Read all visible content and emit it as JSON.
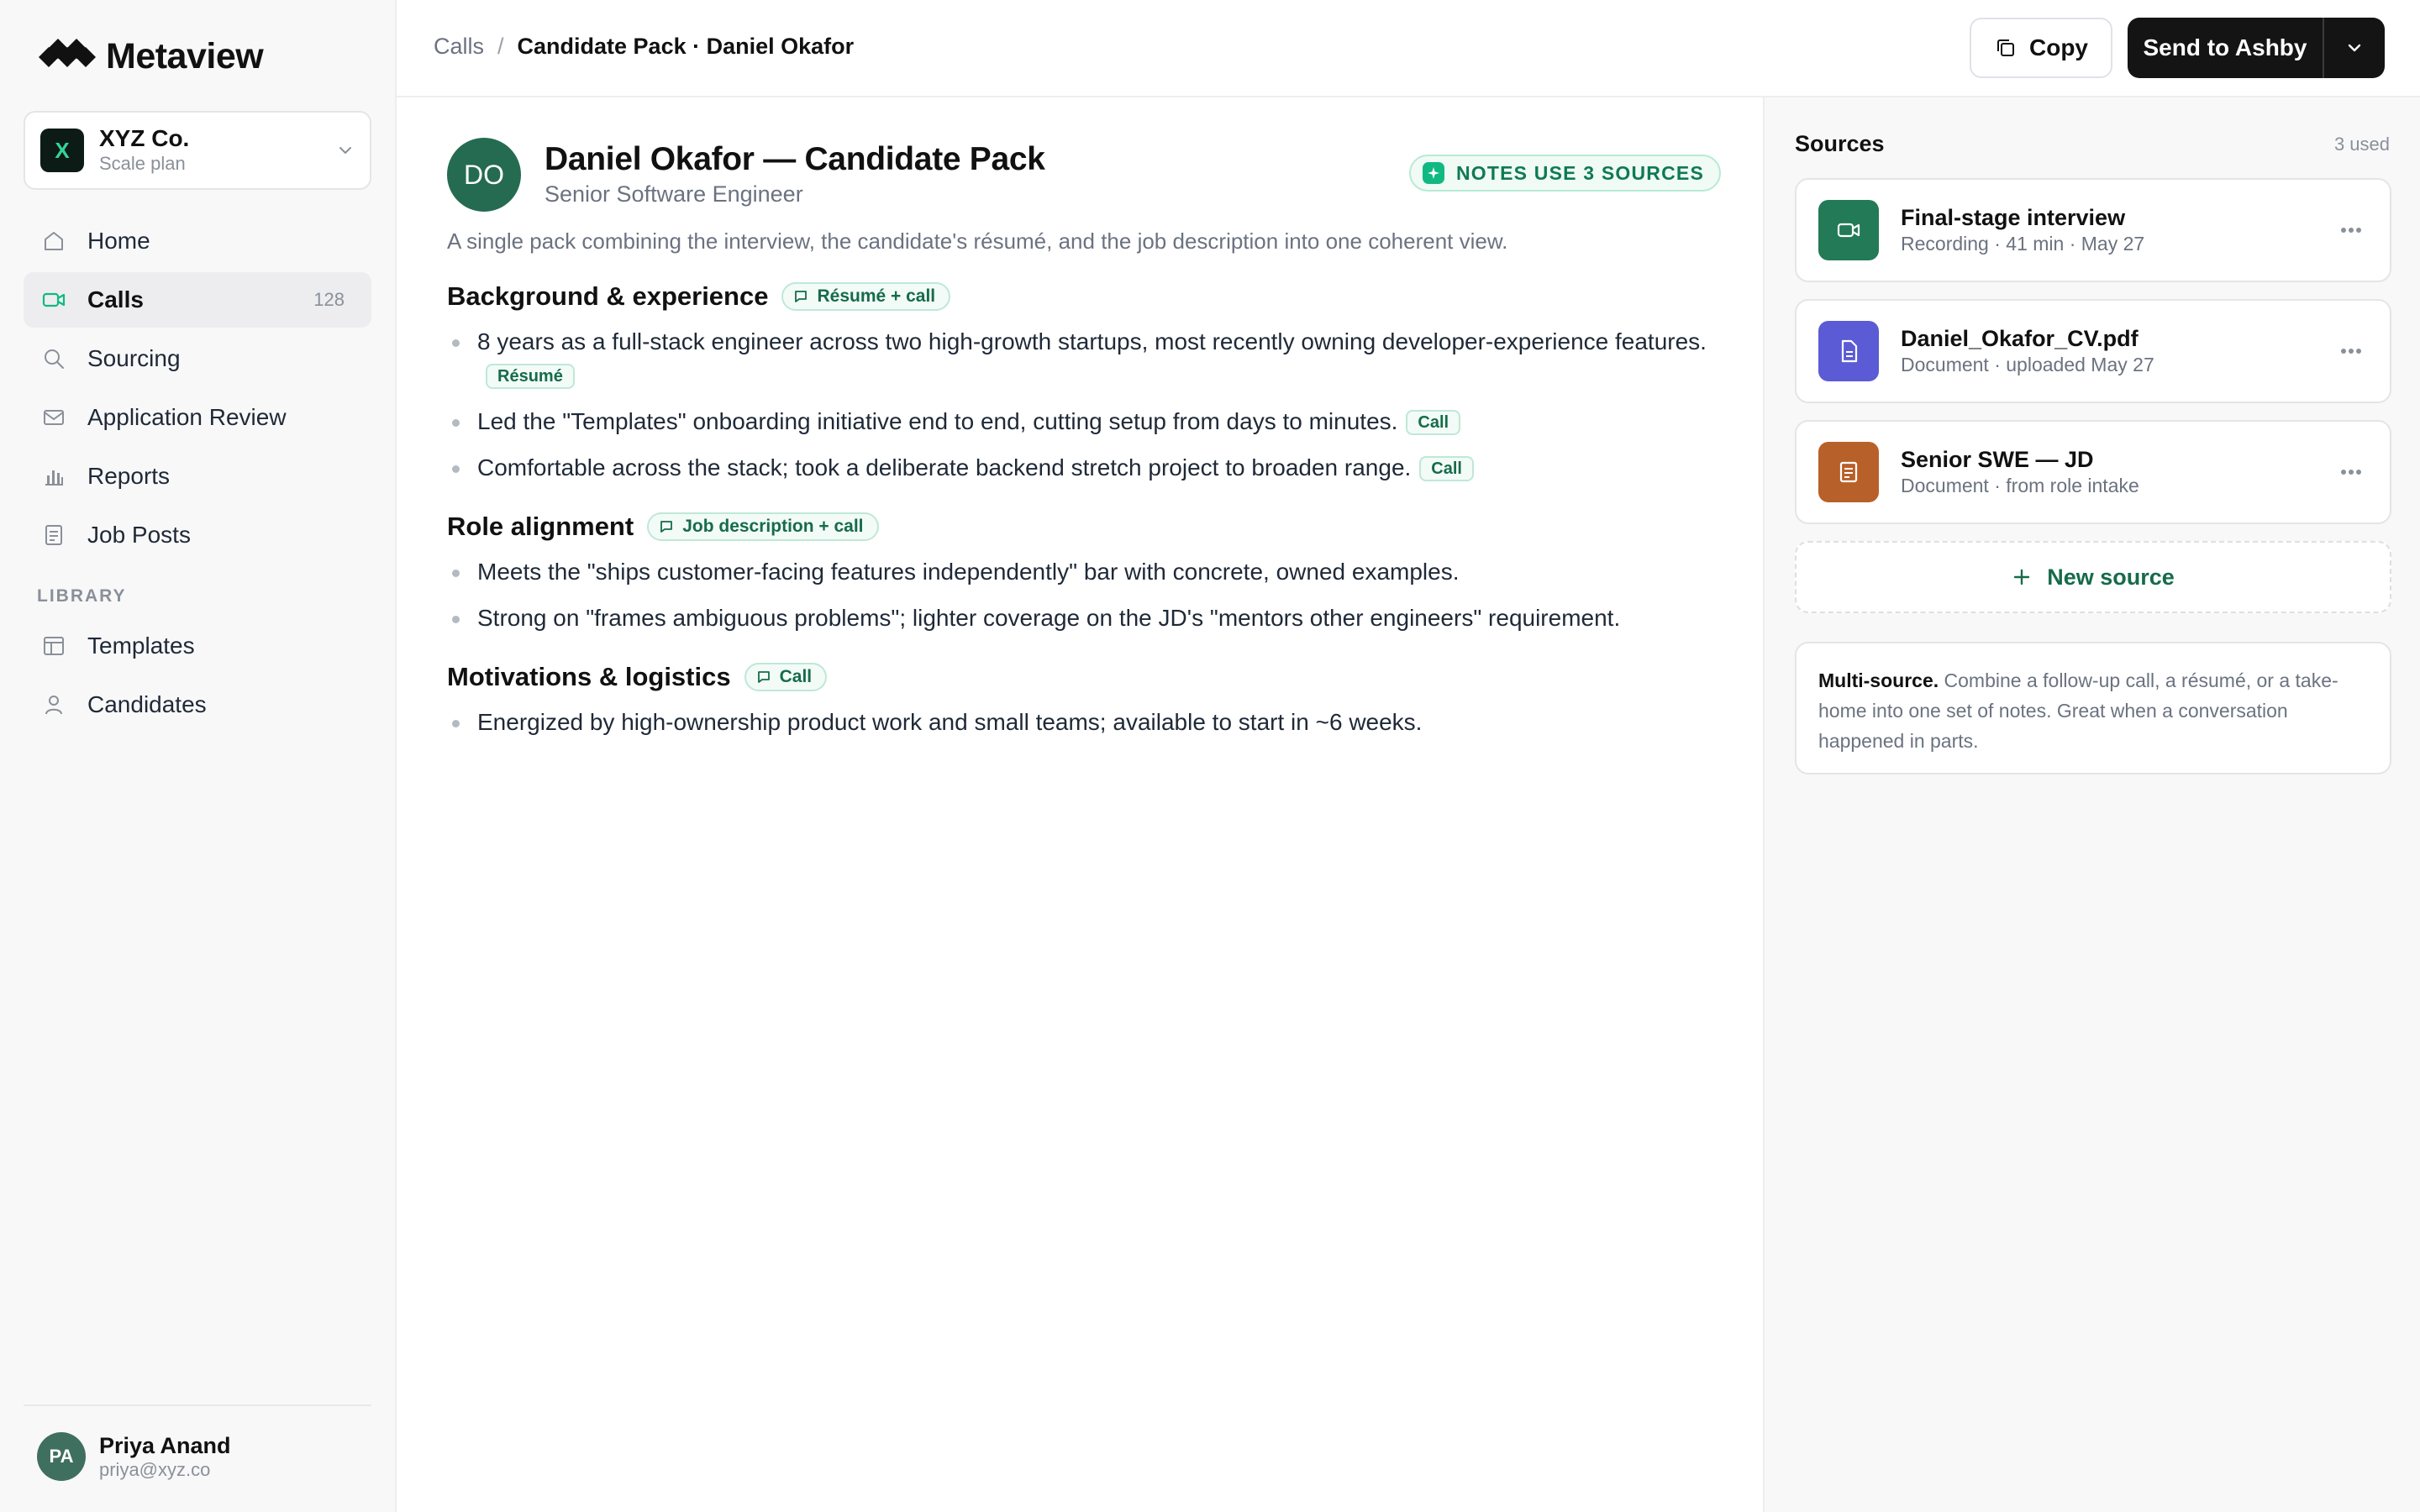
{
  "brand": {
    "name": "Metaview"
  },
  "workspace": {
    "initial": "X",
    "name": "XYZ Co.",
    "plan": "Scale plan"
  },
  "nav": {
    "items": [
      {
        "label": "Home",
        "icon": "home-icon"
      },
      {
        "label": "Calls",
        "icon": "video-icon",
        "count": "128",
        "active": true
      },
      {
        "label": "Sourcing",
        "icon": "search-icon"
      },
      {
        "label": "Application Review",
        "icon": "mail-icon"
      },
      {
        "label": "Reports",
        "icon": "bar-chart-icon"
      },
      {
        "label": "Job Posts",
        "icon": "document-icon"
      }
    ],
    "library_label": "LIBRARY",
    "library_items": [
      {
        "label": "Templates",
        "icon": "template-icon"
      },
      {
        "label": "Candidates",
        "icon": "person-icon"
      }
    ]
  },
  "user": {
    "initials": "PA",
    "name": "Priya Anand",
    "email": "priya@xyz.co"
  },
  "breadcrumb": {
    "root": "Calls",
    "separator": "/",
    "current": "Candidate Pack · Daniel Okafor"
  },
  "toolbar": {
    "copy_label": "Copy",
    "send_label": "Send to Ashby"
  },
  "doc": {
    "initials": "DO",
    "title": "Daniel Okafor — Candidate Pack",
    "subtitle": "Senior Software Engineer",
    "badge": "NOTES USE 3 SOURCES",
    "description": "A single pack combining the interview, the candidate's résumé, and the job description into one coherent view.",
    "sections": [
      {
        "title": "Background & experience",
        "chip": "Résumé + call",
        "bullets": [
          {
            "text": "8 years as a full-stack engineer across two high-growth startups, most recently owning developer-experience features.",
            "tag": "Résumé"
          },
          {
            "text": "Led the \"Templates\" onboarding initiative end to end, cutting setup from days to minutes.",
            "tag": "Call"
          },
          {
            "text": "Comfortable across the stack; took a deliberate backend stretch project to broaden range.",
            "tag": "Call"
          }
        ]
      },
      {
        "title": "Role alignment",
        "chip": "Job description + call",
        "bullets": [
          {
            "text": "Meets the \"ships customer-facing features independently\" bar with concrete, owned examples."
          },
          {
            "text": "Strong on \"frames ambiguous problems\"; lighter coverage on the JD's \"mentors other engineers\" requirement."
          }
        ]
      },
      {
        "title": "Motivations & logistics",
        "chip": "Call",
        "bullets": [
          {
            "text": "Energized by high-ownership product work and small teams; available to start in ~6 weeks."
          }
        ]
      }
    ]
  },
  "sources": {
    "title": "Sources",
    "count": "3 used",
    "items": [
      {
        "name": "Final-stage interview",
        "meta": "Recording · 41 min · May 27",
        "icon": "video-icon",
        "color": "#237a57"
      },
      {
        "name": "Daniel_Okafor_CV.pdf",
        "meta": "Document · uploaded May 27",
        "icon": "file-icon",
        "color": "#5b5bd6"
      },
      {
        "name": "Senior SWE — JD",
        "meta": "Document · from role intake",
        "icon": "document-icon",
        "color": "#b8602a"
      }
    ],
    "new_label": "New source",
    "info_bold": "Multi-source.",
    "info_text": " Combine a follow-up call, a résumé, or a take-home into one set of notes. Great when a conversation happened in parts."
  },
  "colors": {
    "accent": "#166b4a",
    "avatar": "#246b52",
    "button_dark": "#141414"
  }
}
